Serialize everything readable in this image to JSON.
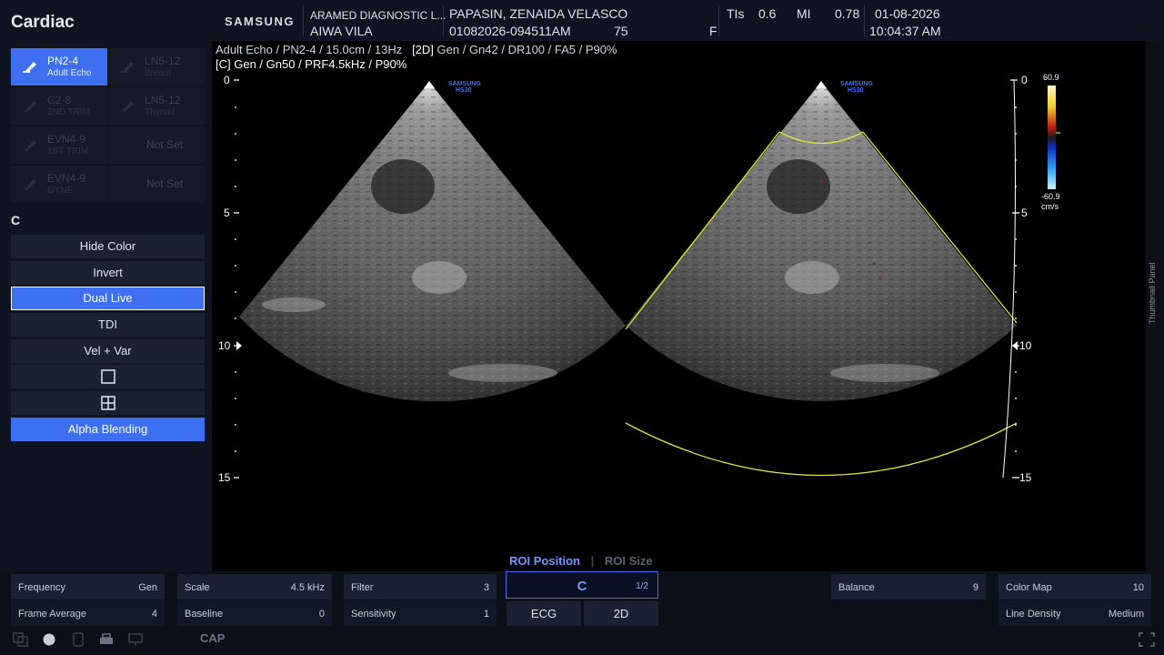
{
  "app": {
    "title": "Cardiac"
  },
  "probes": [
    {
      "name": "PN2-4",
      "sub": "Adult Echo",
      "active": true
    },
    {
      "name": "LN5-12",
      "sub": "Breast",
      "active": false
    },
    {
      "name": "C2-8",
      "sub": "2ND TRIM",
      "active": false
    },
    {
      "name": "LN5-12",
      "sub": "Thyroid",
      "active": false
    },
    {
      "name": "EVN4-9",
      "sub": "1ST TRIM",
      "active": false
    },
    {
      "name": "Not Set",
      "sub": "",
      "active": false
    },
    {
      "name": "EVN4-9",
      "sub": "GYNE",
      "active": false
    },
    {
      "name": "Not Set",
      "sub": "",
      "active": false
    }
  ],
  "mode_label": "C",
  "menu": {
    "hide_color": "Hide Color",
    "invert": "Invert",
    "dual_live": "Dual Live",
    "tdi": "TDI",
    "vel_var": "Vel + Var",
    "alpha_blending": "Alpha Blending"
  },
  "header": {
    "brand": "SAMSUNG",
    "institution": "ARAMED DIAGNOSTIC L...",
    "operator": "AIWA VILA",
    "patient_name": "PAPASIN, ZENAIDA VELASCO",
    "patient_id": "01082026-094511AM",
    "age": "75",
    "sex": "F",
    "tis_label": "TIs",
    "tis_value": "0.6",
    "mi_label": "MI",
    "mi_value": "0.78",
    "date": "01-08-2026",
    "time": "10:04:37 AM"
  },
  "image_info": {
    "line1": "Adult Echo / PN2-4 / 15.0cm / 13Hz",
    "line1_2d_tag": "[2D]",
    "line1_2d": "Gen / Gn42 / DR100 / FA5 / P90%",
    "line2_tag": "[C]",
    "line2": "Gen / Gn50 / PRF4.5kHz / P90%"
  },
  "depth_scale": {
    "left": [
      "0",
      "5",
      "10",
      "15"
    ],
    "right": [
      "0",
      "5",
      "10",
      "15"
    ]
  },
  "probe_mark": {
    "brand": "SAMSUNG",
    "model": "HS30"
  },
  "color_bar": {
    "max": "60.9",
    "min": "-60.9",
    "unit": "cm/s"
  },
  "thumbnail_label": "Thumbnail Panel",
  "roi": {
    "position": "ROI Position",
    "size": "ROI Size"
  },
  "params_row1": [
    {
      "label": "Frequency",
      "value": "Gen"
    },
    {
      "label": "Scale",
      "value": "4.5 kHz"
    },
    {
      "label": "Filter",
      "value": "3"
    },
    {
      "label": "Balance",
      "value": "9"
    },
    {
      "label": "Color Map",
      "value": "10"
    }
  ],
  "params_row2": [
    {
      "label": "Frame Average",
      "value": "4"
    },
    {
      "label": "Baseline",
      "value": "0"
    },
    {
      "label": "Sensitivity",
      "value": "1"
    },
    {
      "label": "Line Density",
      "value": "Medium"
    }
  ],
  "center_mode": {
    "label": "C",
    "page": "1/2"
  },
  "tabs": {
    "ecg": "ECG",
    "twod": "2D"
  },
  "toolbar": {
    "cap": "CAP"
  }
}
